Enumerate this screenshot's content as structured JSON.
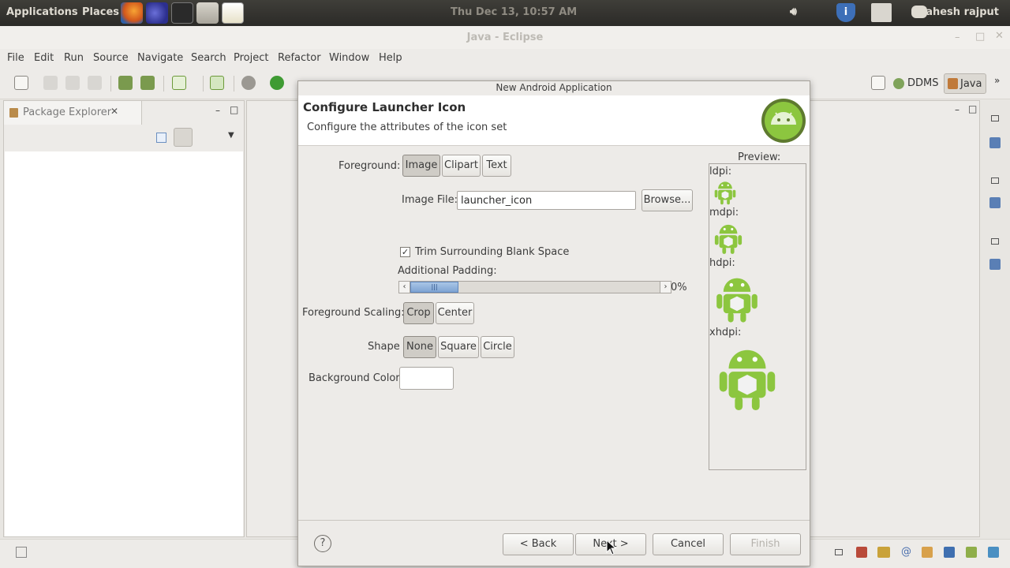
{
  "panel": {
    "menus": [
      "Applications",
      "Places"
    ],
    "clock": "Thu Dec 13, 10:57 AM",
    "user": "mahesh rajput"
  },
  "window": {
    "title": "Java - Eclipse",
    "menus": [
      "File",
      "Edit",
      "Run",
      "Source",
      "Navigate",
      "Search",
      "Project",
      "Refactor",
      "Window",
      "Help"
    ],
    "perspectives": {
      "ddms": "DDMS",
      "java": "Java"
    }
  },
  "package_explorer": {
    "title": "Package Explorer"
  },
  "dialog": {
    "window_title": "New Android Application",
    "heading": "Configure Launcher Icon",
    "subheading": "Configure the attributes of the icon set",
    "foreground": {
      "label": "Foreground:",
      "options": [
        "Image",
        "Clipart",
        "Text"
      ],
      "selected": "Image"
    },
    "image_file": {
      "label": "Image File:",
      "value": "launcher_icon",
      "browse": "Browse..."
    },
    "trim": {
      "label": "Trim Surrounding Blank Space",
      "checked": true,
      "mark": "✓"
    },
    "padding": {
      "label": "Additional Padding:",
      "value": "0%",
      "level": 0
    },
    "scaling": {
      "label": "Foreground Scaling:",
      "options": [
        "Crop",
        "Center"
      ],
      "selected": "Crop"
    },
    "shape": {
      "label": "Shape",
      "options": [
        "None",
        "Square",
        "Circle"
      ],
      "selected": "None"
    },
    "background_color": {
      "label": "Background Color:",
      "value": "#ffffff"
    },
    "preview": {
      "label": "Preview:",
      "densities": [
        "ldpi:",
        "mdpi:",
        "hdpi:",
        "xhdpi:"
      ]
    },
    "buttons": {
      "back": "< Back",
      "next": "Next >",
      "cancel": "Cancel",
      "finish": "Finish"
    },
    "help": "?"
  },
  "colors": {
    "android_green": "#8cc63f",
    "panel_dark": "#3a3935",
    "selection": "#cfccc6"
  }
}
